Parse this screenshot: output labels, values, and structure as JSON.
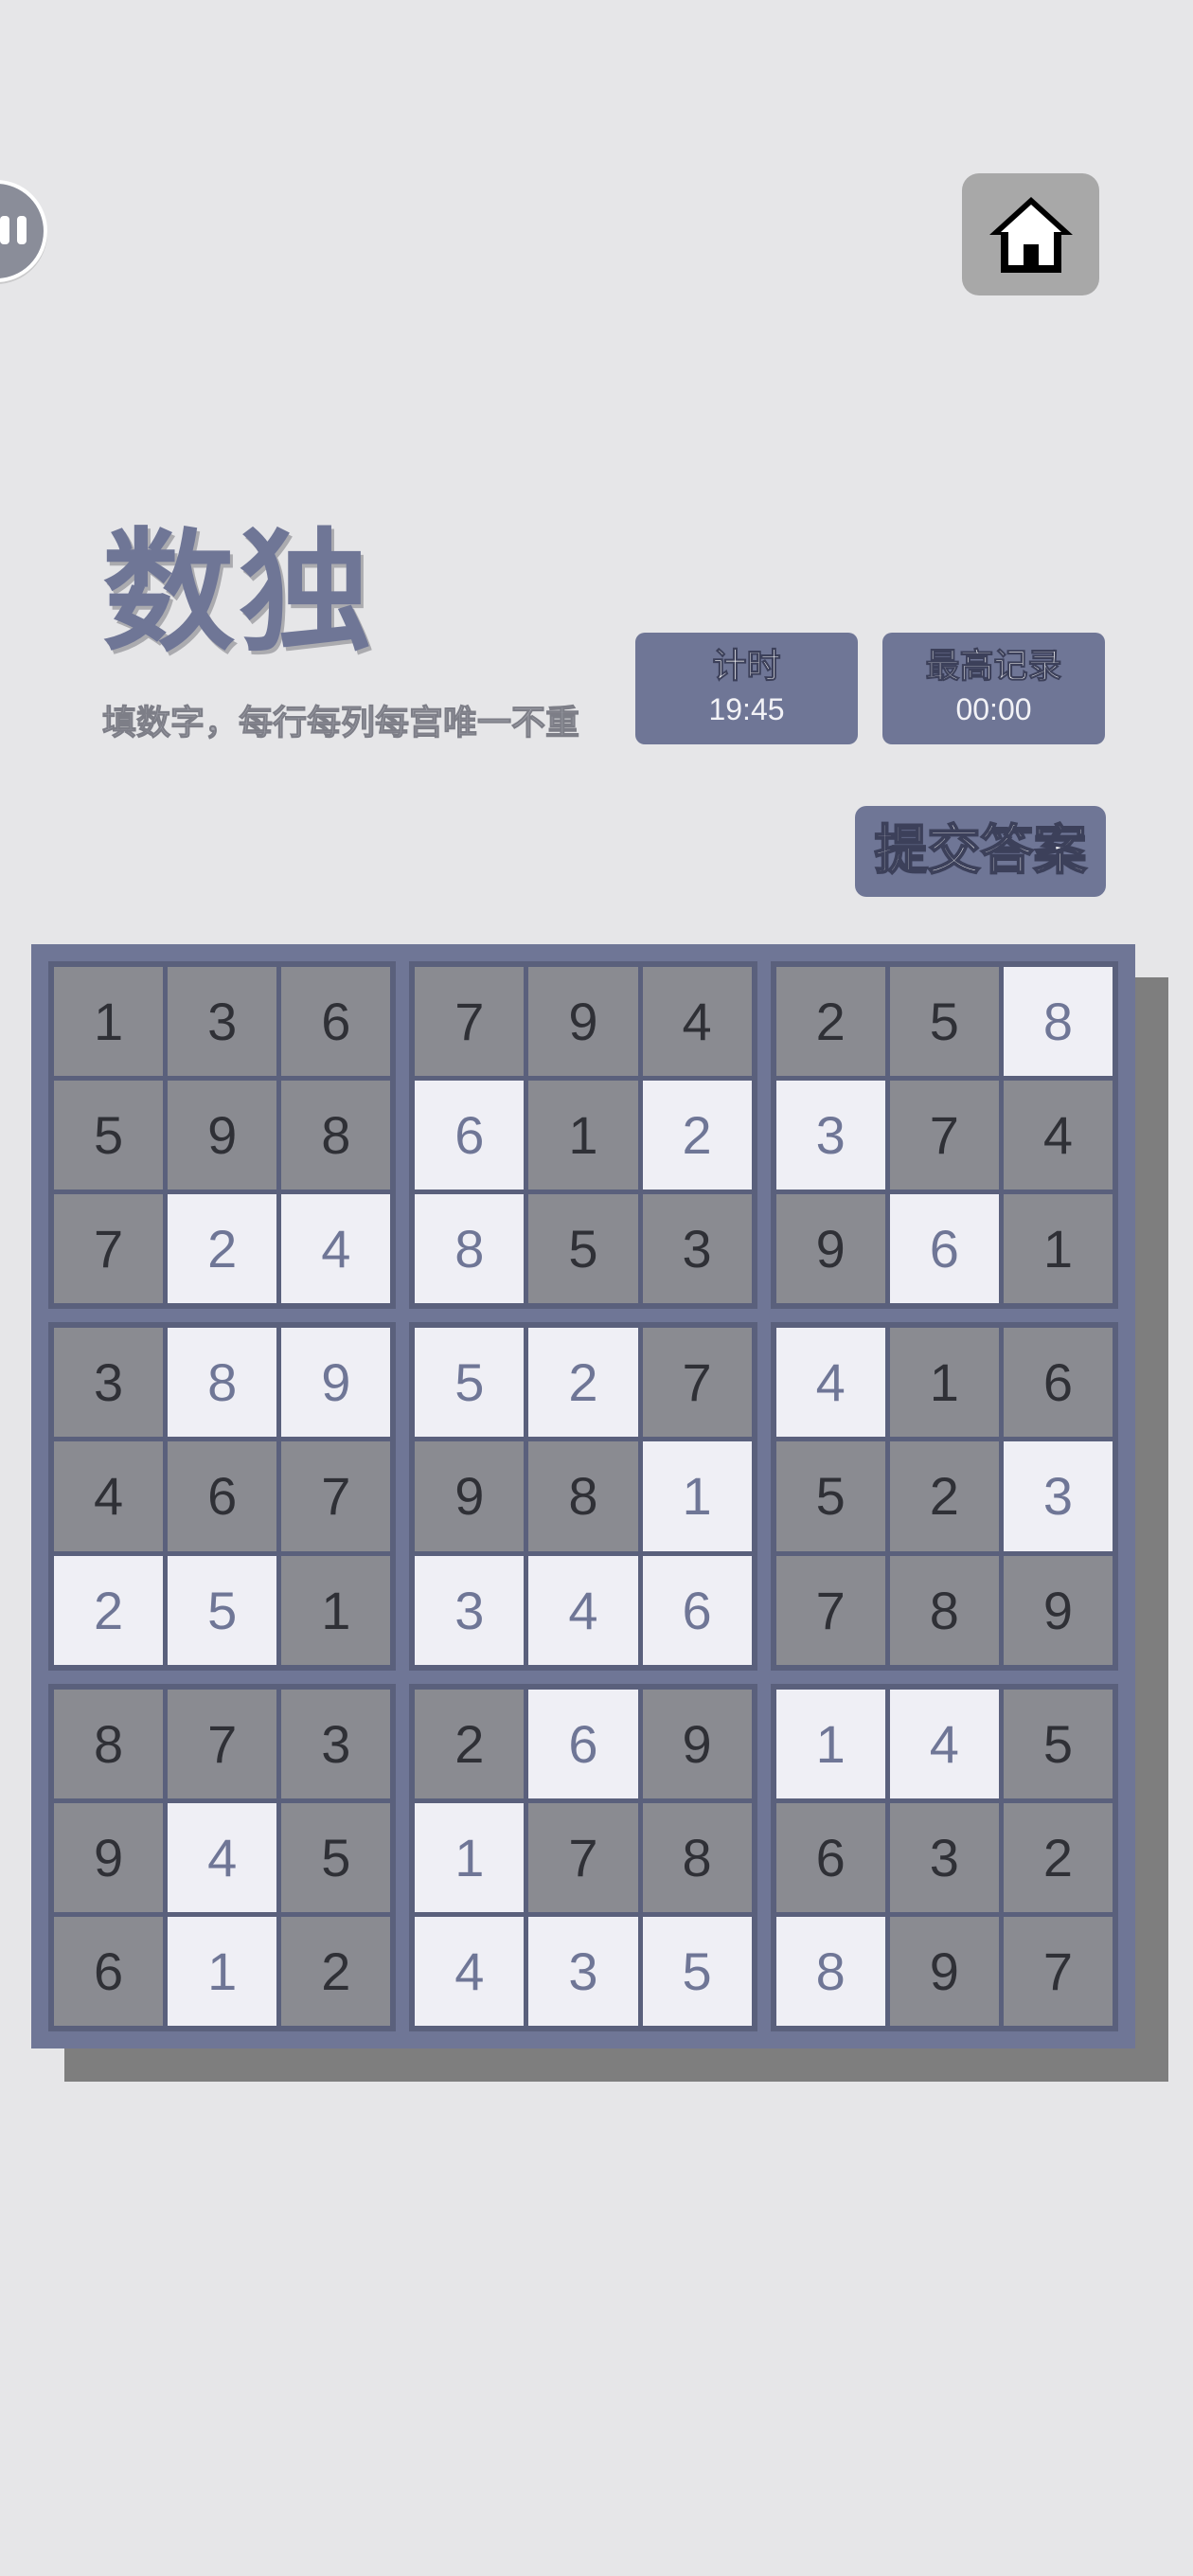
{
  "title": "数独",
  "subtitle": "填数字，每行每列每宫唯一不重",
  "timer": {
    "label": "计时",
    "value": "19:45"
  },
  "record": {
    "label": "最高记录",
    "value": "00:00"
  },
  "submit_label": "提交答案",
  "icons": {
    "pause": "pause-icon",
    "home": "home-icon"
  },
  "colors": {
    "accent": "#6f7696",
    "given_cell": "#8a8b91",
    "input_cell": "#efeff5",
    "background": "#e6e6e8"
  },
  "board": {
    "rows": [
      [
        "1",
        "3",
        "6",
        "7",
        "9",
        "4",
        "2",
        "5",
        "8"
      ],
      [
        "5",
        "9",
        "8",
        "6",
        "1",
        "2",
        "3",
        "7",
        "4"
      ],
      [
        "7",
        "2",
        "4",
        "8",
        "5",
        "3",
        "9",
        "6",
        "1"
      ],
      [
        "3",
        "8",
        "9",
        "5",
        "2",
        "7",
        "4",
        "1",
        "6"
      ],
      [
        "4",
        "6",
        "7",
        "9",
        "8",
        "1",
        "5",
        "2",
        "3"
      ],
      [
        "2",
        "5",
        "1",
        "3",
        "4",
        "6",
        "7",
        "8",
        "9"
      ],
      [
        "8",
        "7",
        "3",
        "2",
        "6",
        "9",
        "1",
        "4",
        "5"
      ],
      [
        "9",
        "4",
        "5",
        "1",
        "7",
        "8",
        "6",
        "3",
        "2"
      ],
      [
        "6",
        "1",
        "2",
        "4",
        "3",
        "5",
        "8",
        "9",
        "7"
      ]
    ],
    "given": [
      [
        true,
        true,
        true,
        true,
        true,
        true,
        true,
        true,
        false
      ],
      [
        true,
        true,
        true,
        false,
        true,
        false,
        false,
        true,
        true
      ],
      [
        true,
        false,
        false,
        false,
        true,
        true,
        true,
        false,
        true
      ],
      [
        true,
        false,
        false,
        false,
        false,
        true,
        false,
        true,
        true
      ],
      [
        true,
        true,
        true,
        true,
        true,
        false,
        true,
        true,
        false
      ],
      [
        false,
        false,
        true,
        false,
        false,
        false,
        true,
        true,
        true
      ],
      [
        true,
        true,
        true,
        true,
        false,
        true,
        false,
        false,
        true
      ],
      [
        true,
        false,
        true,
        false,
        true,
        true,
        true,
        true,
        true
      ],
      [
        true,
        false,
        true,
        false,
        false,
        false,
        false,
        true,
        true
      ]
    ]
  }
}
